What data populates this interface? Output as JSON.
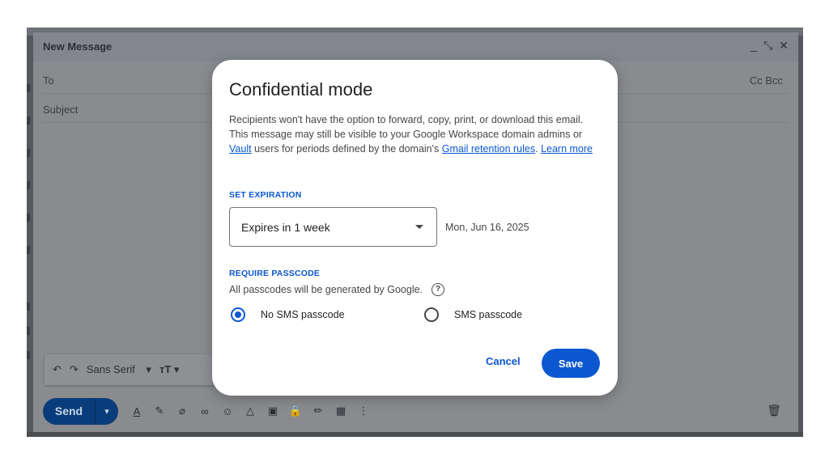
{
  "compose": {
    "title": "New Message",
    "to_label": "To",
    "cc_bcc": "Cc Bcc",
    "subject_label": "Subject",
    "window_controls": [
      "_",
      "⤡",
      "✕"
    ],
    "format_bar": {
      "undo_icon": "↶",
      "redo_icon": "↷",
      "font": "Sans Serif",
      "font_caret": "▾",
      "size_icon": "тT",
      "size_caret": "▾"
    },
    "send_label": "Send",
    "send_more": "▾",
    "trash_icon": "🗑"
  },
  "dialog": {
    "title": "Confidential mode",
    "description_1": "Recipients won't have the option to forward, copy, print, or download this email. This message may still be visible to your Google Workspace domain admins or",
    "link_vault": "Vault",
    "description_2": "users for periods defined by the domain's",
    "link_retention": "Gmail retention rules",
    "description_3": ".",
    "link_learn_more": "Learn more",
    "expiration_label": "SET EXPIRATION",
    "expiration_value": "Expires in 1 week",
    "expiration_date": "Mon, Jun 16, 2025",
    "passcode_label": "REQUIRE PASSCODE",
    "passcode_note": "All passcodes will be generated by Google.",
    "help_icon": "?",
    "option_no_sms": "No SMS passcode",
    "option_sms": "SMS passcode",
    "cancel": "Cancel",
    "save": "Save"
  },
  "colors": {
    "accent": "#0b57d0",
    "overlay": "#898b8e"
  }
}
